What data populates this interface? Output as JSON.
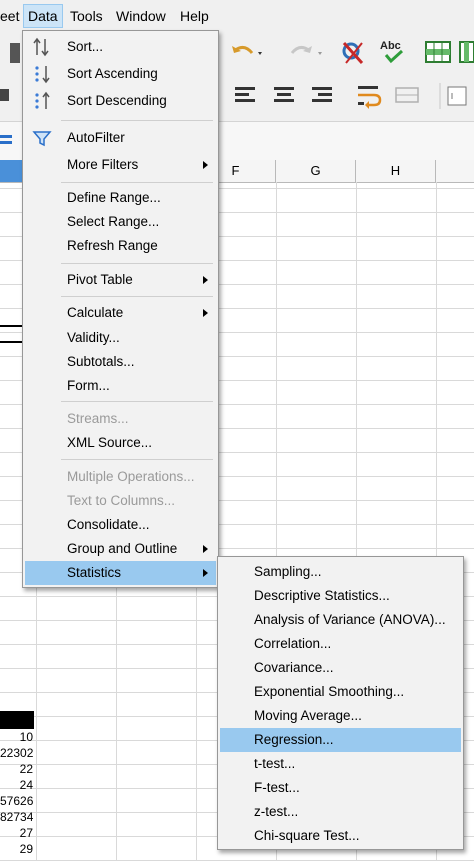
{
  "menubar": {
    "items": [
      {
        "label": "eet",
        "key": "sheet"
      },
      {
        "label": "Data",
        "key": "data"
      },
      {
        "label": "Tools",
        "key": "tools"
      },
      {
        "label": "Window",
        "key": "window"
      },
      {
        "label": "Help",
        "key": "help"
      }
    ]
  },
  "columns": [
    "F",
    "G",
    "H"
  ],
  "cells": [
    {
      "value": "10"
    },
    {
      "value": "22302"
    },
    {
      "value": "22"
    },
    {
      "value": "24"
    },
    {
      "value": "57626"
    },
    {
      "value": "82734"
    },
    {
      "value": "27"
    },
    {
      "value": "29"
    }
  ],
  "data_menu": {
    "items": [
      {
        "label": "Sort...",
        "icon": "sort-icon"
      },
      {
        "label": "Sort Ascending",
        "icon": "sort-ascending-icon"
      },
      {
        "label": "Sort Descending",
        "icon": "sort-descending-icon"
      },
      {
        "label": "AutoFilter",
        "icon": "autofilter-icon"
      },
      {
        "label": "More Filters",
        "submenu": true
      },
      {
        "label": "Define Range..."
      },
      {
        "label": "Select Range..."
      },
      {
        "label": "Refresh Range"
      },
      {
        "label": "Pivot Table",
        "submenu": true
      },
      {
        "label": "Calculate",
        "submenu": true
      },
      {
        "label": "Validity..."
      },
      {
        "label": "Subtotals..."
      },
      {
        "label": "Form..."
      },
      {
        "label": "Streams...",
        "disabled": true
      },
      {
        "label": "XML Source..."
      },
      {
        "label": "Multiple Operations...",
        "disabled": true
      },
      {
        "label": "Text to Columns...",
        "disabled": true
      },
      {
        "label": "Consolidate..."
      },
      {
        "label": "Group and Outline",
        "submenu": true
      },
      {
        "label": "Statistics",
        "submenu": true,
        "highlighted": true
      }
    ]
  },
  "statistics_menu": {
    "items": [
      {
        "label": "Sampling..."
      },
      {
        "label": "Descriptive Statistics..."
      },
      {
        "label": "Analysis of Variance (ANOVA)..."
      },
      {
        "label": "Correlation..."
      },
      {
        "label": "Covariance..."
      },
      {
        "label": "Exponential Smoothing..."
      },
      {
        "label": "Moving Average..."
      },
      {
        "label": "Regression...",
        "highlighted": true
      },
      {
        "label": "t-test..."
      },
      {
        "label": "F-test..."
      },
      {
        "label": "z-test..."
      },
      {
        "label": "Chi-square Test..."
      }
    ]
  },
  "colors": {
    "highlight": "#99c9ef",
    "menu_bg": "#f2f2f2",
    "disabled_text": "#9a9a9a"
  }
}
